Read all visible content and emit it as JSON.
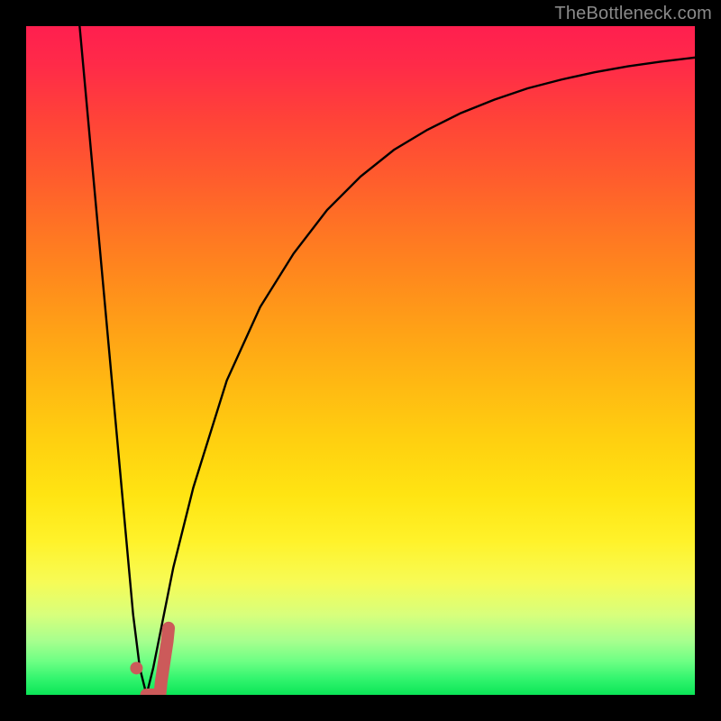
{
  "watermark": "TheBottleneck.com",
  "chart_data": {
    "type": "line",
    "title": "",
    "xlabel": "",
    "ylabel": "",
    "xlim": [
      0,
      100
    ],
    "ylim": [
      0,
      100
    ],
    "grid": false,
    "series": [
      {
        "name": "left-branch",
        "x": [
          8.0,
          10.0,
          12.0,
          14.0,
          15.0,
          16.0,
          17.0,
          18.0
        ],
        "y": [
          100.0,
          78.0,
          56.0,
          34.0,
          23.0,
          12.0,
          4.0,
          0.0
        ]
      },
      {
        "name": "right-branch",
        "x": [
          18.0,
          19.0,
          20.0,
          22.0,
          25.0,
          30.0,
          35.0,
          40.0,
          45.0,
          50.0,
          55.0,
          60.0,
          65.0,
          70.0,
          75.0,
          80.0,
          85.0,
          90.0,
          95.0,
          100.0
        ],
        "y": [
          0.0,
          4.0,
          9.0,
          19.0,
          31.0,
          47.0,
          58.0,
          66.0,
          72.5,
          77.5,
          81.5,
          84.5,
          87.0,
          89.0,
          90.7,
          92.0,
          93.1,
          94.0,
          94.7,
          95.3
        ]
      },
      {
        "name": "marker-tick",
        "x": [
          20.0,
          20.2,
          20.5,
          20.8,
          21.1,
          21.3
        ],
        "y": [
          0.0,
          2.0,
          4.0,
          6.0,
          8.0,
          10.0
        ]
      }
    ],
    "marker_dot": {
      "x": 16.5,
      "y": 4.0
    },
    "colors": {
      "curve": "#000000",
      "marker": "#cc5a5a",
      "gradient_top": "#ff1f4f",
      "gradient_bottom": "#0be557"
    }
  }
}
